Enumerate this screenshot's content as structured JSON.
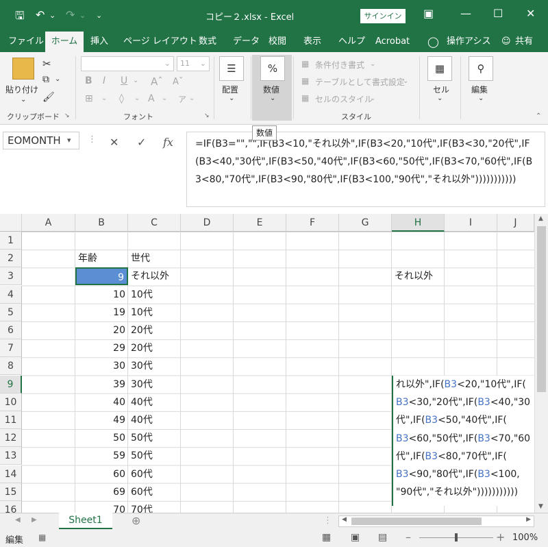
{
  "titlebar": {
    "title": "コピー２.xlsx  -  Excel",
    "signin": "サインイン",
    "undo_drop": "⌄",
    "customize": "⌄"
  },
  "menu": [
    "ファイル",
    "ホーム",
    "挿入",
    "ページ レイアウト",
    "数式",
    "データ",
    "校閲",
    "表示",
    "ヘルプ",
    "Acrobat",
    "操作アシス",
    "共有"
  ],
  "ribbon": {
    "paste_label": "貼り付け",
    "clipboard_label": "クリップボード",
    "font_label": "フォント",
    "font_size": "11",
    "bold": "B",
    "italic": "I",
    "underline": "U",
    "align_label": "配置",
    "number_label": "数値",
    "number_icon": "%",
    "cond_format": "条件付き書式",
    "table_format": "テーブルとして書式設定",
    "cell_style": "セルのスタイル",
    "style_label": "スタイル",
    "cell_label": "セル",
    "edit_label": "編集",
    "tooltip": "数値"
  },
  "formula_bar": {
    "name_box": "EOMONTH",
    "formula": "=IF(B3=\"\",\"\",IF(B3<10,\"それ以外\",IF(B3<20,\"10代\",IF(B3<30,\"20代\",IF(B3<40,\"30代\",IF(B3<50,\"40代\",IF(B3<60,\"50代\",IF(B3<70,\"60代\",IF(B3<80,\"70代\",IF(B3<90,\"80代\",IF(B3<100,\"90代\",\"それ以外\")))))))))))",
    "fx": "fx"
  },
  "columns": [
    "A",
    "B",
    "C",
    "D",
    "E",
    "F",
    "G",
    "H",
    "I",
    "J"
  ],
  "rows": [
    "1",
    "2",
    "3",
    "4",
    "5",
    "6",
    "7",
    "8",
    "9",
    "10",
    "11",
    "12",
    "13",
    "14",
    "15",
    "16"
  ],
  "headers": {
    "age": "年齢",
    "generation": "世代"
  },
  "data": [
    {
      "age": "9",
      "gen": "それ以外"
    },
    {
      "age": "10",
      "gen": "10代"
    },
    {
      "age": "19",
      "gen": "10代"
    },
    {
      "age": "20",
      "gen": "20代"
    },
    {
      "age": "29",
      "gen": "20代"
    },
    {
      "age": "30",
      "gen": "30代"
    },
    {
      "age": "39",
      "gen": "30代"
    },
    {
      "age": "40",
      "gen": "40代"
    },
    {
      "age": "49",
      "gen": "40代"
    },
    {
      "age": "50",
      "gen": "50代"
    },
    {
      "age": "59",
      "gen": "50代"
    },
    {
      "age": "60",
      "gen": "60代"
    },
    {
      "age": "69",
      "gen": "60代"
    },
    {
      "age": "70",
      "gen": "70代"
    }
  ],
  "h3_value": "それ以外",
  "edit_lines": [
    [
      "れ以外\",IF(",
      "B3",
      "<20,\"10代\",IF("
    ],
    [
      "B3",
      "<30,\"20代\",IF(",
      "B3",
      "<40,\"30"
    ],
    [
      "代\",IF(",
      "B3",
      "<50,\"40代\",IF("
    ],
    [
      "B3",
      "<60,\"50代\",IF(",
      "B3",
      "<70,\"60"
    ],
    [
      "代\",IF(",
      "B3",
      "<80,\"70代\",IF("
    ],
    [
      "B3",
      "<90,\"80代\",IF(",
      "B3",
      "<100,"
    ],
    [
      "\"90代\",\"それ以外\")))))))))))"
    ]
  ],
  "sheet": {
    "tab": "Sheet1"
  },
  "status": {
    "mode": "編集",
    "zoom": "100%"
  }
}
